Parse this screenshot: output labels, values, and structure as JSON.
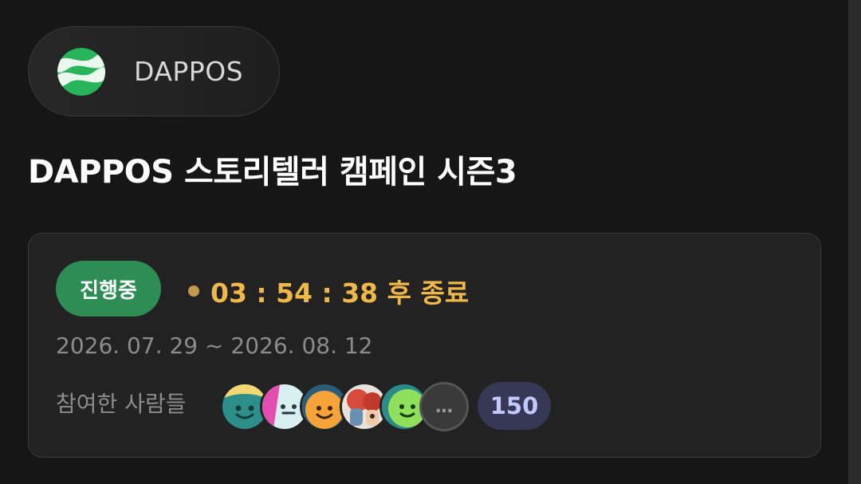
{
  "project": {
    "name": "DAPPOS",
    "logo_icon": "dappos-logo-icon"
  },
  "campaign": {
    "title": "DAPPOS 스토리텔러 캠페인 시즌3"
  },
  "status": {
    "badge": "진행중",
    "timer_text": "03 : 54 : 38 후 종료",
    "date_range": "2026. 07. 29 ~ 2026. 08. 12",
    "participants_label": "참여한 사람들",
    "participants_count": "150",
    "more_icon": "…"
  },
  "colors": {
    "background": "#161616",
    "card": "#222222",
    "badge_green": "#2e8d55",
    "timer_gold": "#f0b849",
    "count_pill": "#373855"
  }
}
